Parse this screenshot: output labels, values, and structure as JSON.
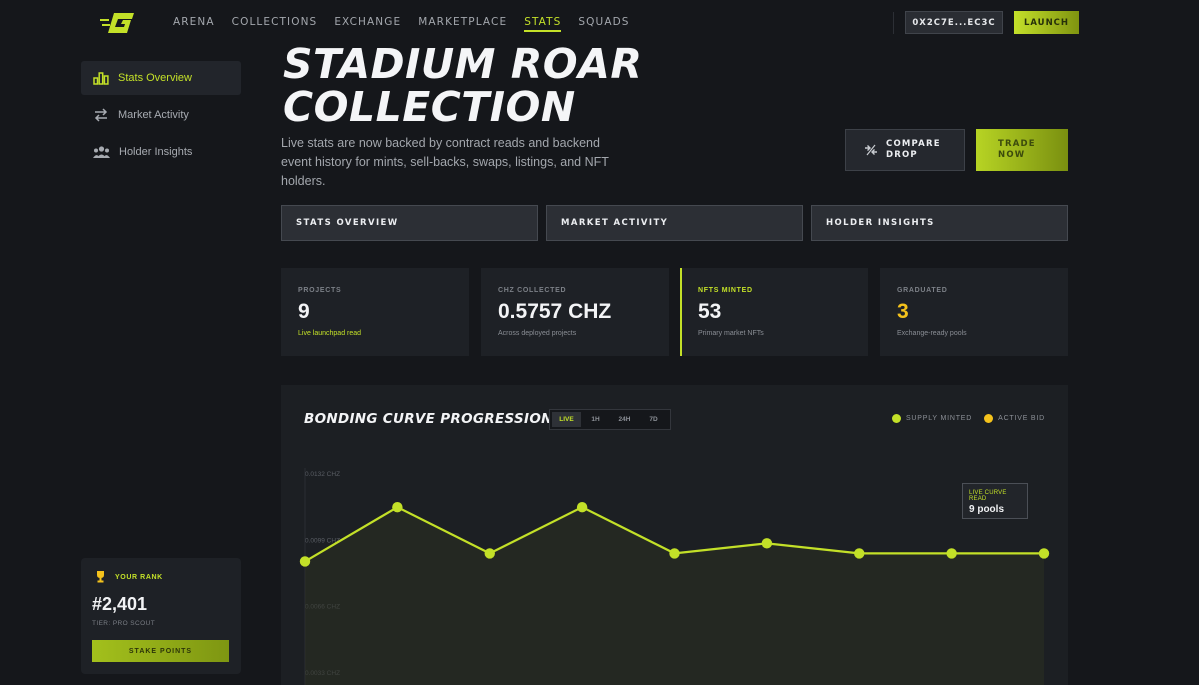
{
  "header": {
    "nav": [
      "ARENA",
      "COLLECTIONS",
      "EXCHANGE",
      "MARKETPLACE",
      "STATS",
      "SQUADS"
    ],
    "active_nav": "STATS",
    "wallet_label": "0X2C7E...EC3C",
    "launch_label": "LAUNCH"
  },
  "sidebar": {
    "items": [
      {
        "label": "Stats Overview",
        "icon": "bar-chart-icon"
      },
      {
        "label": "Market Activity",
        "icon": "swap-arrows-icon"
      },
      {
        "label": "Holder Insights",
        "icon": "users-icon"
      }
    ],
    "rank": {
      "label": "YOUR RANK",
      "value": "#2,401",
      "tier": "TIER: PRO SCOUT",
      "button_label": "STAKE POINTS"
    }
  },
  "hero": {
    "title_line1": "STADIUM ROAR",
    "title_line2": "COLLECTION",
    "description": "Live stats are now backed by contract reads and backend event history for mints, sell-backs, swaps, listings, and NFT holders.",
    "compare_label_1": "COMPARE",
    "compare_label_2": "DROP",
    "trade_label_1": "TRADE",
    "trade_label_2": "NOW"
  },
  "tabs": [
    "STATS OVERVIEW",
    "MARKET ACTIVITY",
    "HOLDER INSIGHTS"
  ],
  "stats": [
    {
      "label": "PROJECTS",
      "value": "9",
      "sub": "Live launchpad read"
    },
    {
      "label": "CHZ COLLECTED",
      "value": "0.5757 CHZ",
      "sub": "Across deployed projects"
    },
    {
      "label": "NFTS MINTED",
      "value": "53",
      "sub": "Primary market NFTs"
    },
    {
      "label": "GRADUATED",
      "value": "3",
      "sub": "Exchange-ready pools"
    }
  ],
  "colors": {
    "accent": "#c3e028",
    "gold": "#f4c21c",
    "background": "#15171b",
    "panel": "#1e2126"
  },
  "chart": {
    "title": "BONDING CURVE PROGRESSION",
    "ranges": [
      "LIVE",
      "1H",
      "24H",
      "7D"
    ],
    "active_range": "LIVE",
    "legend": [
      {
        "name": "SUPPLY MINTED",
        "color": "#c3e028"
      },
      {
        "name": "ACTIVE BID",
        "color": "#f4c21c"
      }
    ],
    "tooltip": {
      "label": "LIVE CURVE READ",
      "value": "9 pools"
    }
  },
  "chart_data": {
    "type": "area",
    "ylabels": [
      "0.0132 CHZ",
      "0.0099 CHZ",
      "0.0066 CHZ",
      "0.0033 CHZ"
    ],
    "ylim": [
      0.0033,
      0.0132
    ],
    "series": [
      {
        "name": "SUPPLY MINTED",
        "values": [
          0.0088,
          0.0115,
          0.0092,
          0.0115,
          0.0092,
          0.0097,
          0.0092,
          0.0092,
          0.0092
        ]
      }
    ],
    "grid": false
  }
}
